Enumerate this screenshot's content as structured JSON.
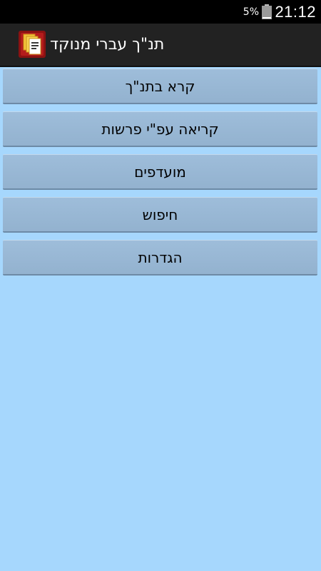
{
  "status_bar": {
    "battery_percent": "5%",
    "time": "21:12"
  },
  "action_bar": {
    "title": "תנ\"ך עברי מנוקד",
    "icon": "book-pages-icon"
  },
  "menu": {
    "items": [
      {
        "label": "קרא בתנ\"ך"
      },
      {
        "label": "קריאה עפ\"י פרשות"
      },
      {
        "label": "מועדפים"
      },
      {
        "label": "חיפוש"
      },
      {
        "label": "הגדרות"
      }
    ]
  },
  "colors": {
    "background": "#a6d7fd",
    "button": "#9ab9d6",
    "action_bar": "#222222",
    "status_bar": "#000000"
  }
}
